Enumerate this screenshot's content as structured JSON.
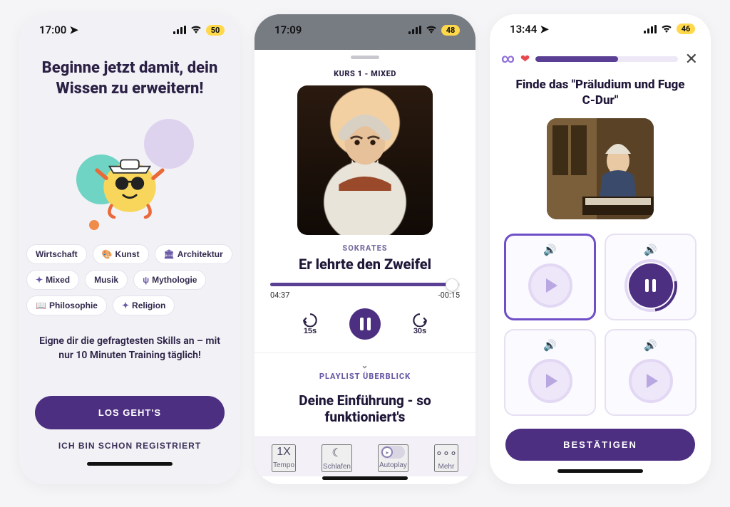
{
  "colors": {
    "primary": "#4d2f82",
    "accent": "#6f4fc7"
  },
  "screen1": {
    "status": {
      "time": "17:00",
      "battery": "50"
    },
    "title": "Beginne jetzt damit, dein Wissen zu erweitern!",
    "chips": [
      "Wirtschaft",
      "Kunst",
      "Architektur",
      "Mixed",
      "Musik",
      "Mythologie",
      "Philosophie",
      "Religion"
    ],
    "subtitle": "Eigne dir die gefragtesten Skills an – mit nur 10 Minuten Training täglich!",
    "cta_primary": "LOS GEHT'S",
    "cta_secondary": "ICH BIN SCHON REGISTRIERT"
  },
  "screen2": {
    "status": {
      "time": "17:09",
      "battery": "48"
    },
    "course_label": "KURS 1 - MIXED",
    "speaker": "SOKRATES",
    "title": "Er lehrte den Zweifel",
    "elapsed": "04:37",
    "remaining": "-00:15",
    "skip_back": "15s",
    "skip_fwd": "30s",
    "playlist_label": "PLAYLIST ÜBERBLICK",
    "next_title": "Deine Einführung - so funktioniert's",
    "bottom": {
      "tempo_value": "1X",
      "tempo_label": "Tempo",
      "sleep_label": "Schlafen",
      "autoplay_label": "Autoplay",
      "more_label": "Mehr"
    }
  },
  "screen3": {
    "status": {
      "time": "13:44",
      "battery": "46"
    },
    "question": "Finde das \"Präludium und Fuge C-Dur\"",
    "confirm": "BESTÄTIGEN"
  }
}
